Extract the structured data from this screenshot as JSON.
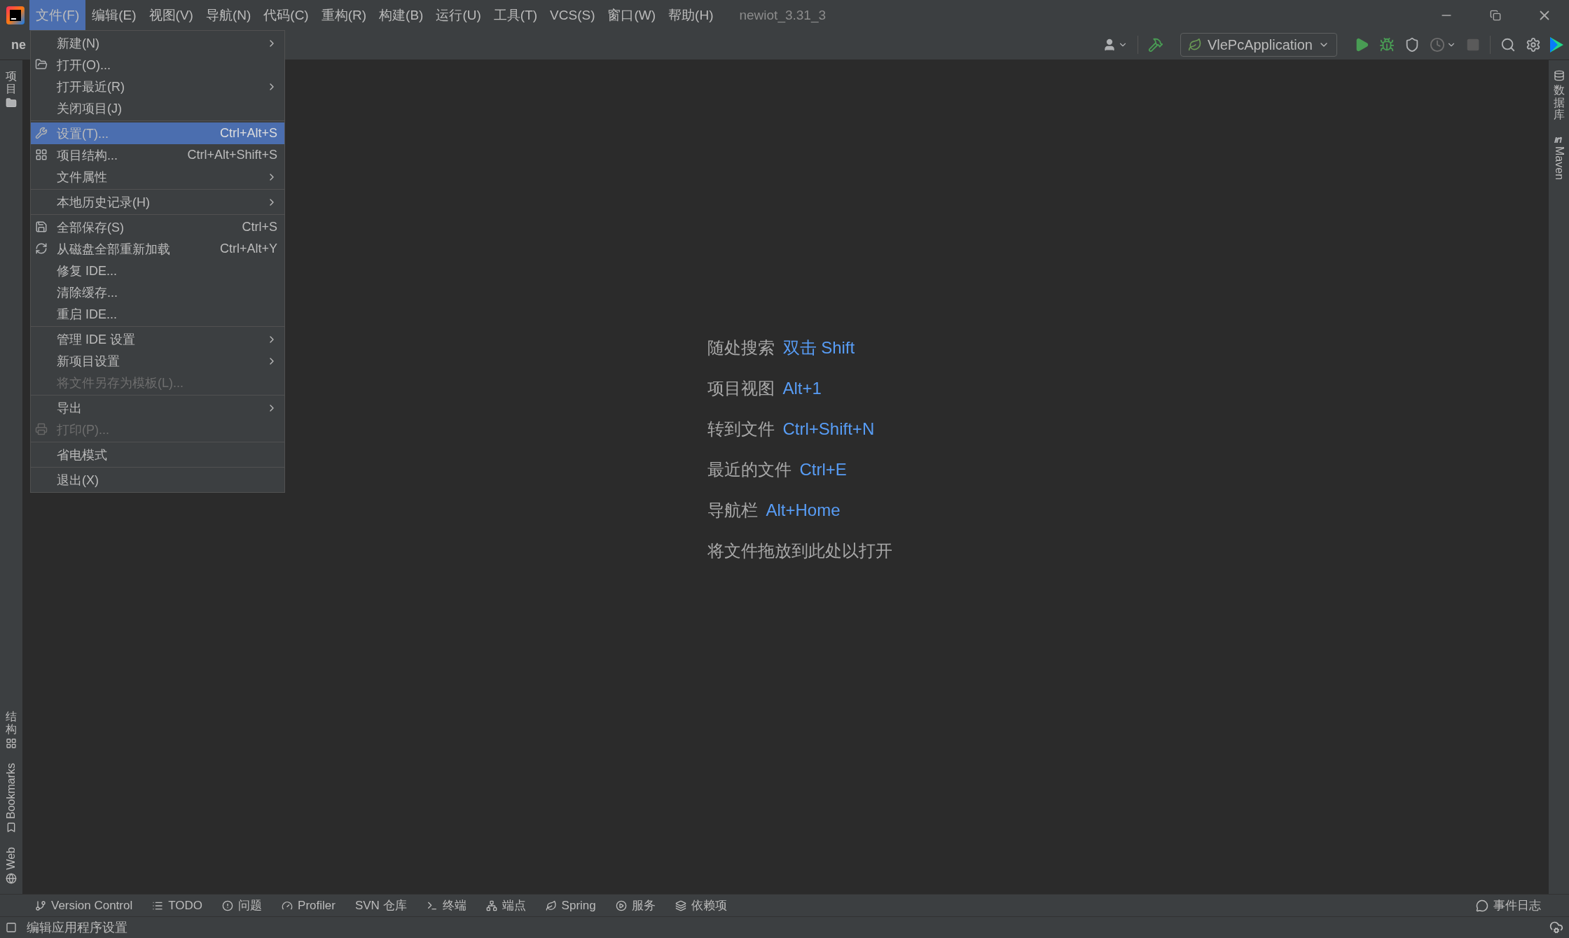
{
  "window": {
    "title": "newiot_3.31_3"
  },
  "menu_bar": [
    {
      "label": "文件(F)",
      "selected": true
    },
    {
      "label": "编辑(E)",
      "selected": false
    },
    {
      "label": "视图(V)",
      "selected": false
    },
    {
      "label": "导航(N)",
      "selected": false
    },
    {
      "label": "代码(C)",
      "selected": false
    },
    {
      "label": "重构(R)",
      "selected": false
    },
    {
      "label": "构建(B)",
      "selected": false
    },
    {
      "label": "运行(U)",
      "selected": false
    },
    {
      "label": "工具(T)",
      "selected": false
    },
    {
      "label": "VCS(S)",
      "selected": false
    },
    {
      "label": "窗口(W)",
      "selected": false
    },
    {
      "label": "帮助(H)",
      "selected": false
    }
  ],
  "toolbar": {
    "breadcrumb": "ne",
    "run_configuration": "VlePcApplication"
  },
  "file_menu": {
    "groups": [
      [
        {
          "label": "新建(N)",
          "submenu": true,
          "selected": false,
          "disabled": false
        },
        {
          "label": "打开(O)...",
          "submenu": false,
          "selected": false,
          "disabled": false
        },
        {
          "label": "打开最近(R)",
          "submenu": true,
          "selected": false,
          "disabled": false
        },
        {
          "label": "关闭项目(J)",
          "submenu": false,
          "selected": false,
          "disabled": false
        }
      ],
      [
        {
          "label": "设置(T)...",
          "shortcut": "Ctrl+Alt+S",
          "submenu": false,
          "selected": true,
          "disabled": false
        },
        {
          "label": "项目结构...",
          "shortcut": "Ctrl+Alt+Shift+S",
          "submenu": false,
          "selected": false,
          "disabled": false
        },
        {
          "label": "文件属性",
          "submenu": true,
          "selected": false,
          "disabled": false
        }
      ],
      [
        {
          "label": "本地历史记录(H)",
          "submenu": true,
          "selected": false,
          "disabled": false
        }
      ],
      [
        {
          "label": "全部保存(S)",
          "shortcut": "Ctrl+S",
          "submenu": false,
          "selected": false,
          "disabled": false
        },
        {
          "label": "从磁盘全部重新加载",
          "shortcut": "Ctrl+Alt+Y",
          "submenu": false,
          "selected": false,
          "disabled": false
        },
        {
          "label": "修复 IDE...",
          "submenu": false,
          "selected": false,
          "disabled": false
        },
        {
          "label": "清除缓存...",
          "submenu": false,
          "selected": false,
          "disabled": false
        },
        {
          "label": "重启 IDE...",
          "submenu": false,
          "selected": false,
          "disabled": false
        }
      ],
      [
        {
          "label": "管理 IDE 设置",
          "submenu": true,
          "selected": false,
          "disabled": false
        },
        {
          "label": "新项目设置",
          "submenu": true,
          "selected": false,
          "disabled": false
        },
        {
          "label": "将文件另存为模板(L)...",
          "submenu": false,
          "selected": false,
          "disabled": true
        }
      ],
      [
        {
          "label": "导出",
          "submenu": true,
          "selected": false,
          "disabled": false
        },
        {
          "label": "打印(P)...",
          "submenu": false,
          "selected": false,
          "disabled": true
        }
      ],
      [
        {
          "label": "省电模式",
          "submenu": false,
          "selected": false,
          "disabled": false
        }
      ],
      [
        {
          "label": "退出(X)",
          "submenu": false,
          "selected": false,
          "disabled": false
        }
      ]
    ]
  },
  "welcome_hints": [
    {
      "label": "随处搜索",
      "shortcut": "双击 Shift"
    },
    {
      "label": "项目视图",
      "shortcut": "Alt+1"
    },
    {
      "label": "转到文件",
      "shortcut": "Ctrl+Shift+N"
    },
    {
      "label": "最近的文件",
      "shortcut": "Ctrl+E"
    },
    {
      "label": "导航栏",
      "shortcut": "Alt+Home"
    },
    {
      "label": "将文件拖放到此处以打开"
    }
  ],
  "left_tool_stripe": {
    "top": [
      {
        "label": "项目"
      }
    ],
    "bottom": [
      {
        "label": "结构"
      },
      {
        "label": "Bookmarks"
      },
      {
        "label": "Web"
      }
    ]
  },
  "right_tool_stripe": [
    {
      "label": "数据库"
    },
    {
      "label": "Maven"
    }
  ],
  "tool_window_bar": {
    "left": [
      "Version Control",
      "TODO",
      "问题",
      "Profiler",
      "SVN 仓库",
      "终端",
      "端点",
      "Spring",
      "服务",
      "依赖项"
    ],
    "right": [
      "事件日志"
    ]
  },
  "status_bar": {
    "message": "编辑应用程序设置"
  }
}
